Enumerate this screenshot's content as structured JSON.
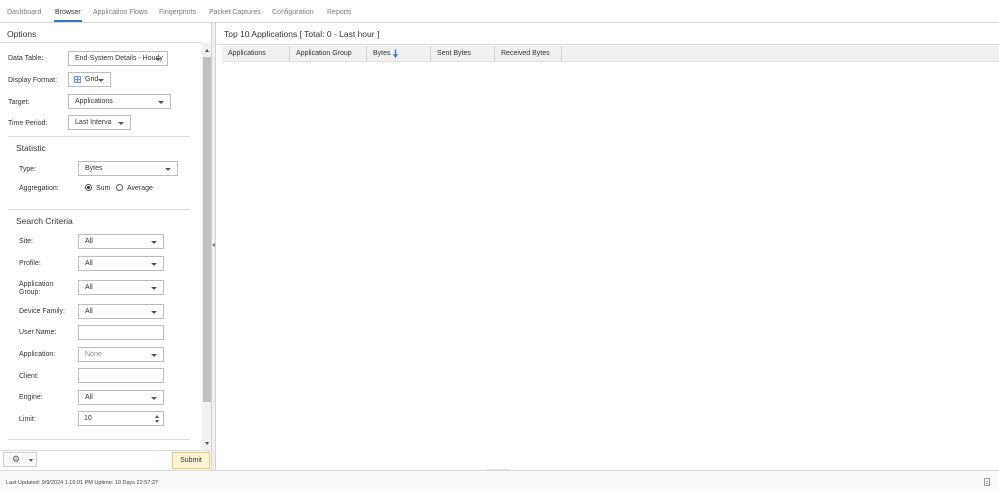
{
  "tabs": [
    {
      "label": "Dashboard",
      "active": false
    },
    {
      "label": "Browser",
      "active": true
    },
    {
      "label": "Application Flows",
      "active": false
    },
    {
      "label": "Fingerprints",
      "active": false
    },
    {
      "label": "Packet Captures",
      "active": false
    },
    {
      "label": "Configuration",
      "active": false
    },
    {
      "label": "Reports",
      "active": false
    }
  ],
  "options": {
    "title": "Options",
    "data_table": {
      "label": "Data Table:",
      "value": "End-System Details - Hourly"
    },
    "display_format": {
      "label": "Display Format:",
      "value": "Grid",
      "icon": "grid-icon"
    },
    "target": {
      "label": "Target:",
      "value": "Applications"
    },
    "time_period": {
      "label": "Time Period:",
      "value": "Last Interva"
    },
    "statistic": {
      "title": "Statistic",
      "type": {
        "label": "Type:",
        "value": "Bytes"
      },
      "aggregation": {
        "label": "Aggregation:",
        "sum_label": "Sum",
        "average_label": "Average",
        "selected": "Sum"
      }
    },
    "search_criteria": {
      "title": "Search Criteria",
      "site": {
        "label": "Site:",
        "value": "All"
      },
      "profile": {
        "label": "Profile:",
        "value": "All"
      },
      "application_group": {
        "label": "Application Group:",
        "value": "All"
      },
      "device_family": {
        "label": "Device Family:",
        "value": "All"
      },
      "user_name": {
        "label": "User Name:",
        "value": ""
      },
      "application": {
        "label": "Application:",
        "value": "None"
      },
      "client": {
        "label": "Client:",
        "value": ""
      },
      "engine": {
        "label": "Engine:",
        "value": "All"
      },
      "limit": {
        "label": "Limit:",
        "value": "10"
      }
    },
    "submit_label": "Submit",
    "gear_icon": "gear-icon"
  },
  "results": {
    "title": "Top 10 Applications [ Total: 0 - Last hour ]",
    "columns": [
      "Applications",
      "Application Group",
      "Bytes",
      "Sent Bytes",
      "Received Bytes"
    ],
    "sorted_column": "Bytes",
    "sort_direction": "descending",
    "rows": []
  },
  "status": {
    "text": "Last Updated: 9/9/2024 1:16:01 PM   Uptime: 10 Days 22:57:27"
  },
  "colors": {
    "accent": "#2f7bbf",
    "submit_bg": "#fff5d6",
    "submit_border": "#e5c97a"
  }
}
